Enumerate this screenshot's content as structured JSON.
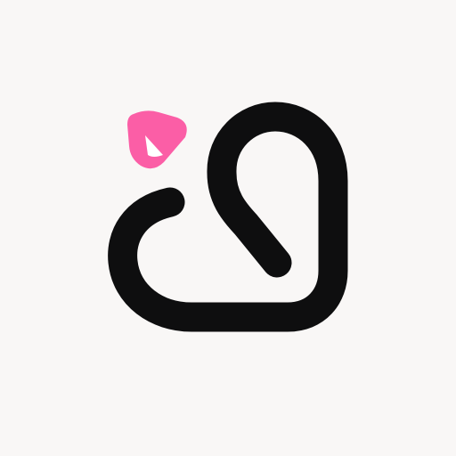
{
  "logo": {
    "icon": "heart-line-logo-icon",
    "accent_icon": "pink-rounded-triangle-icon",
    "colors": {
      "background": "#f9f7f6",
      "stroke": "#0e0e0f",
      "accent": "#fb5ea6",
      "accent_inner": "#ffffff"
    }
  }
}
